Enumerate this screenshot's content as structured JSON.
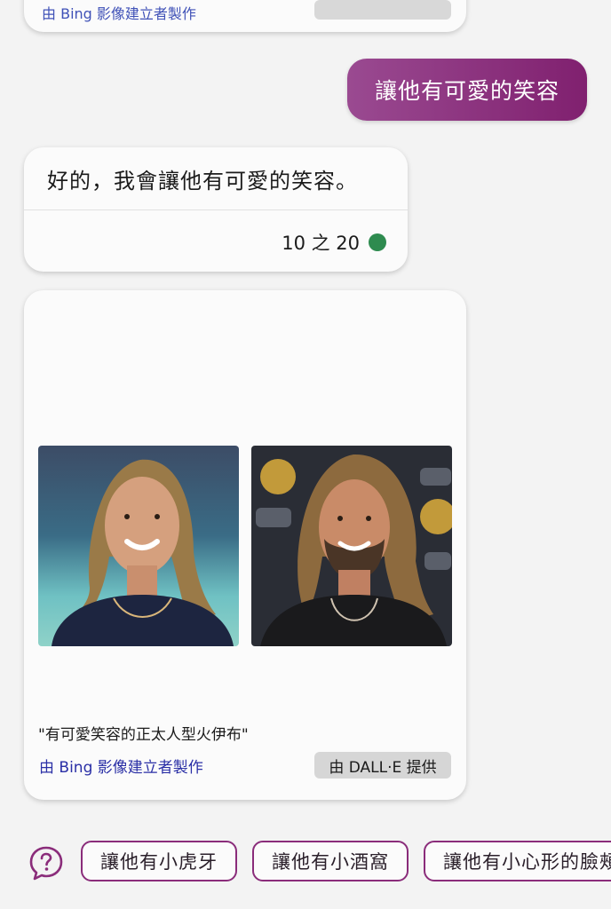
{
  "top_card": {
    "link_fragment": "由 Bing 影像建立者製作"
  },
  "user_message": {
    "text": "讓他有可愛的笑容",
    "gradient_start": "#9a4a91",
    "gradient_end": "#80206f"
  },
  "bot_message": {
    "text": "好的，我會讓他有可愛的笑容。",
    "counter": "10 之 20",
    "status_color": "#2e8b4f"
  },
  "image_card": {
    "images": [
      {
        "icon": "portrait-image-1"
      },
      {
        "icon": "portrait-image-2"
      }
    ],
    "caption": "\"有可愛笑容的正太人型火伊布\"",
    "creator_link": "由 Bing 影像建立者製作",
    "dalle_badge": "由 DALL·E 提供"
  },
  "suggestions": {
    "help_icon": "question-bubble-icon",
    "chips": [
      {
        "label": "讓他有小虎牙"
      },
      {
        "label": "讓他有小酒窩"
      },
      {
        "label": "讓他有小心形的臉頰"
      }
    ],
    "accent_color": "#8a2c7a"
  }
}
